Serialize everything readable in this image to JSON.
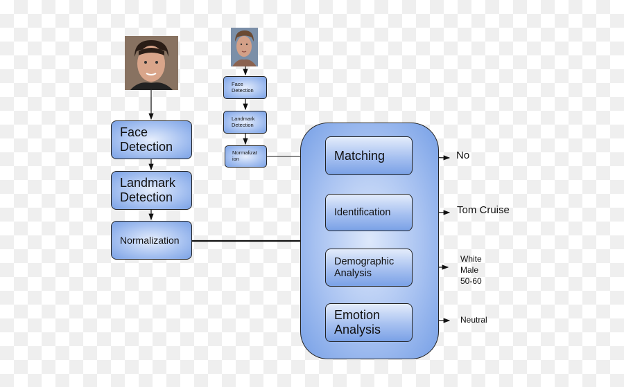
{
  "left_pipeline": {
    "face_detection": "Face\nDetection",
    "landmark_detection": "Landmark\nDetection",
    "normalization": "Normalization"
  },
  "right_pipeline": {
    "face_detection": "Face\nDetection",
    "landmark_detection": "Landmark\nDetection",
    "normalization": "Normalizat\nion"
  },
  "analysis": {
    "matching": "Matching",
    "identification": "Identification",
    "demographic": "Demographic\nAnalysis",
    "emotion": "Emotion\nAnalysis"
  },
  "outputs": {
    "matching": "No",
    "identification": "Tom Cruise",
    "demographic": "White\nMale\n50-60",
    "emotion": "Neutral"
  },
  "colors": {
    "box_fill": "#a9c3f1",
    "box_edge": "#222222"
  }
}
